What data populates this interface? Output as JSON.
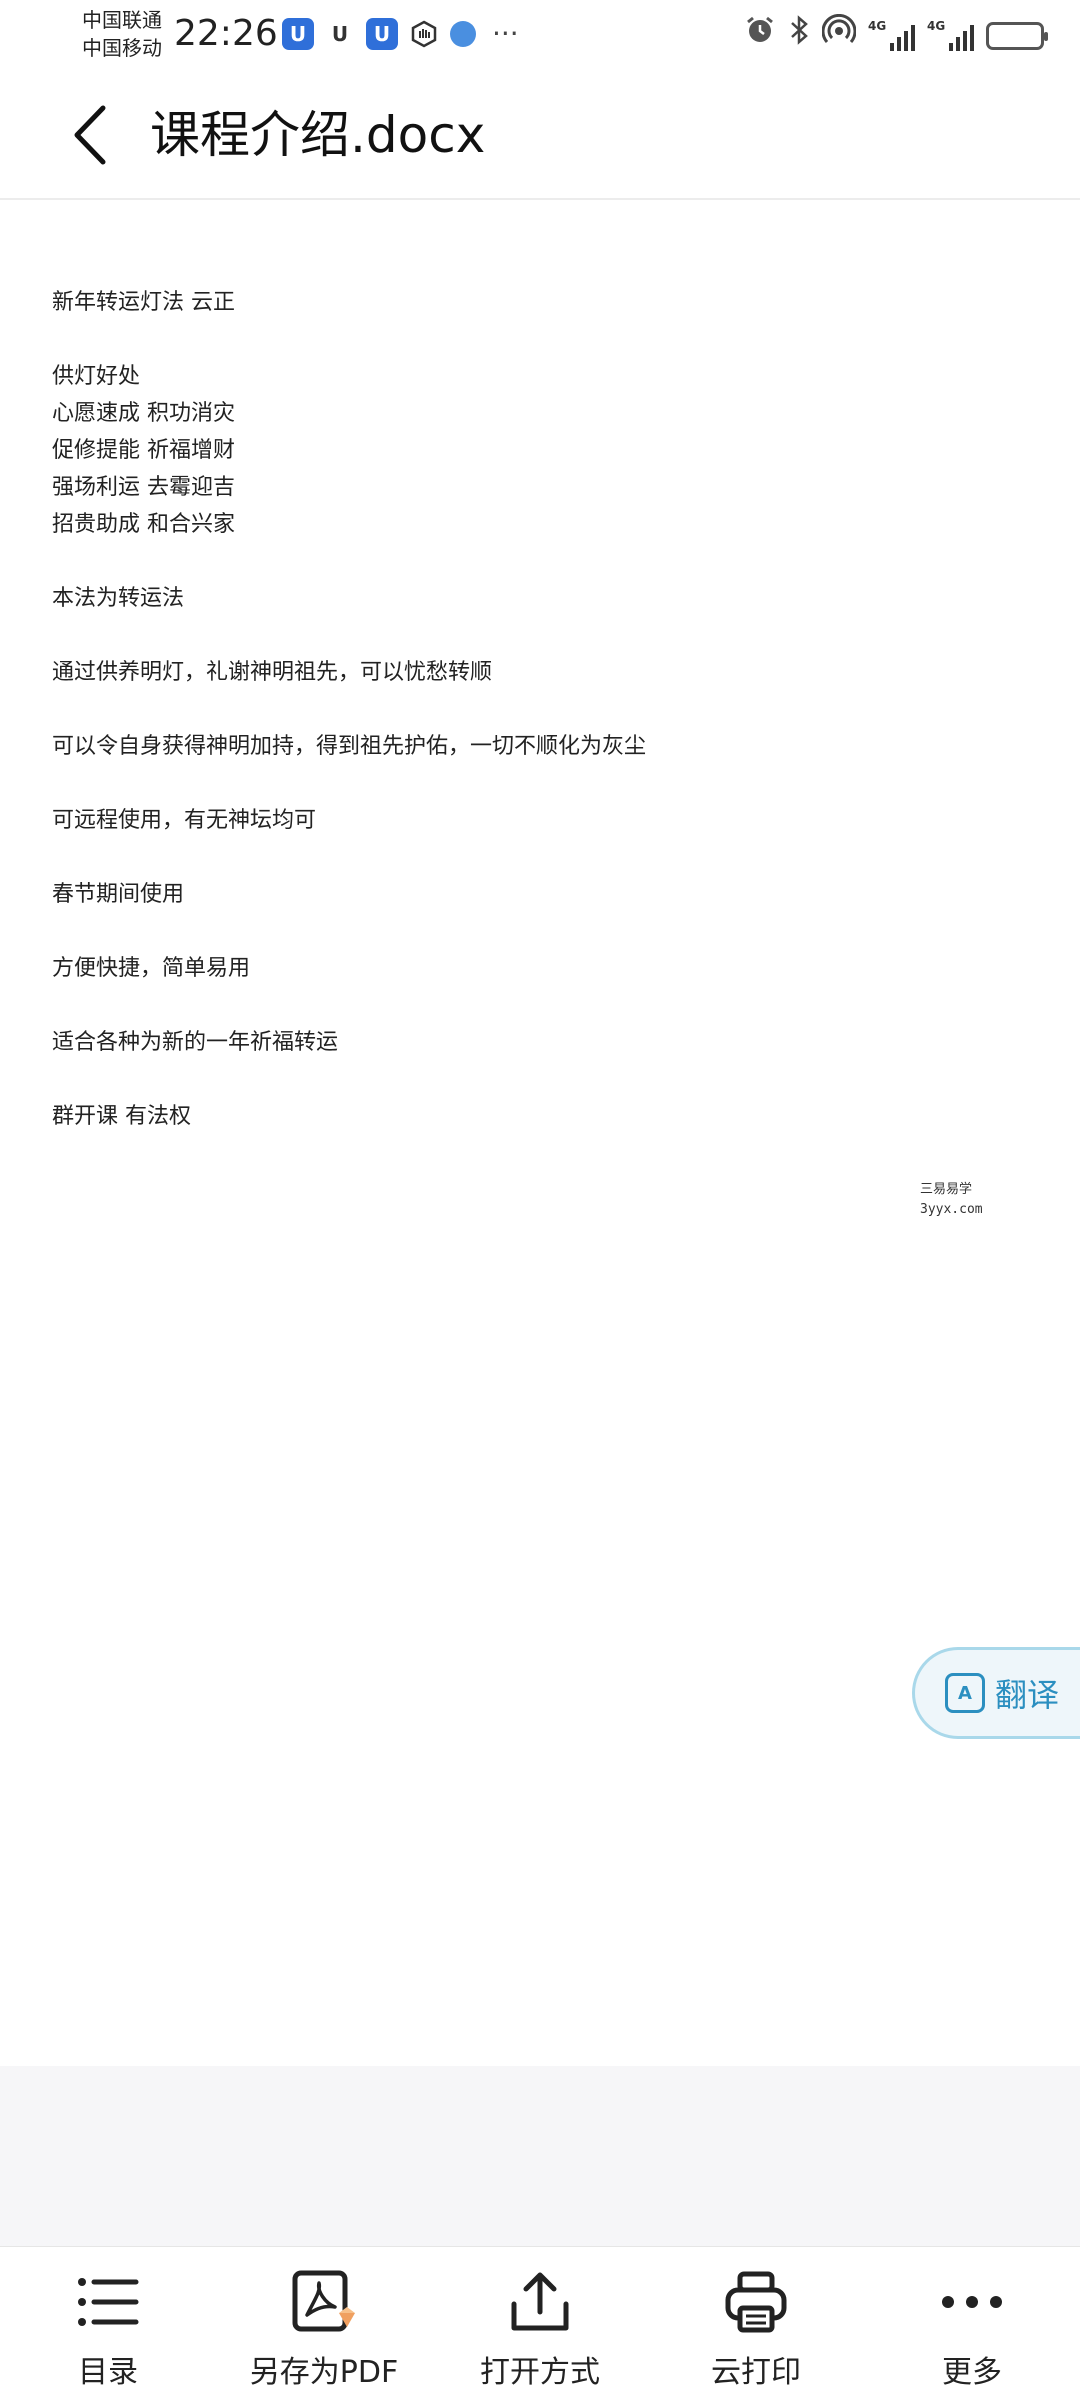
{
  "status_bar": {
    "carrier_1": "中国联通",
    "carrier_2": "中国移动",
    "time": "22:26",
    "more": "···",
    "signal_1_tag": "4G",
    "signal_2_tag": "4G"
  },
  "header": {
    "title": "课程介绍.docx"
  },
  "document": {
    "lines": [
      "新年转运灯法  云正",
      "供灯好处",
      "心愿速成  积功消灾",
      "促修提能  祈福增财",
      "强场利运  去霉迎吉",
      "招贵助成  和合兴家",
      "本法为转运法",
      "通过供养明灯，礼谢神明祖先，可以忧愁转顺",
      "可以令自身获得神明加持，得到祖先护佑，一切不顺化为灰尘",
      "可远程使用，有无神坛均可",
      "春节期间使用",
      "方便快捷，简单易用",
      "适合各种为新的一年祈福转运",
      "群开课  有法权"
    ],
    "watermark_line_1": "三易易学",
    "watermark_line_2": "3yyx.com"
  },
  "translate_button": {
    "label": "翻译"
  },
  "toolbar": {
    "items": [
      {
        "label": "目录",
        "icon": "list-icon"
      },
      {
        "label": "另存为PDF",
        "icon": "pdf-icon"
      },
      {
        "label": "打开方式",
        "icon": "share-icon"
      },
      {
        "label": "云打印",
        "icon": "printer-icon"
      },
      {
        "label": "更多",
        "icon": "more-icon"
      }
    ]
  },
  "colors": {
    "accent": "#2b8fc0",
    "battery_fill": "#f5b400"
  }
}
